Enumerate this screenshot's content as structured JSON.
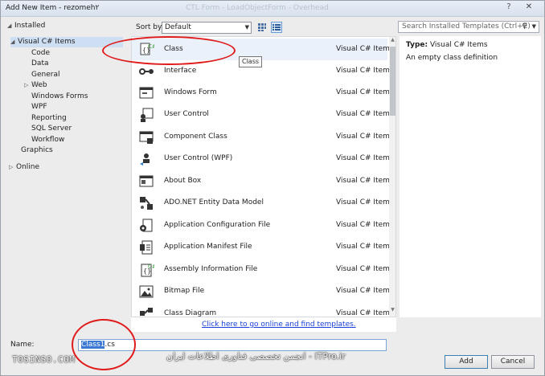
{
  "window": {
    "title": "Add New Item - rezomeh۲",
    "ghost_title": "CTL Form - LoadObjectForm - Overhead",
    "help_label": "?",
    "close_label": "✕"
  },
  "tree": {
    "installed": "Installed",
    "items": [
      {
        "label": "Visual C# Items",
        "selected": true
      },
      {
        "label": "Code"
      },
      {
        "label": "Data"
      },
      {
        "label": "General"
      },
      {
        "label": "Web"
      },
      {
        "label": "Windows Forms"
      },
      {
        "label": "WPF"
      },
      {
        "label": "Reporting"
      },
      {
        "label": "SQL Server"
      },
      {
        "label": "Workflow"
      },
      {
        "label": "Graphics"
      }
    ],
    "online": "Online"
  },
  "toolbar": {
    "sort_label": "Sort by:",
    "sort_value": "Default",
    "grid_view_icon": "grid-view-icon",
    "list_view_icon": "list-view-icon"
  },
  "search": {
    "placeholder": "Search Installed Templates (Ctrl+E)",
    "icon": "search-icon"
  },
  "templates": [
    {
      "name": "Class",
      "category": "Visual C# Items",
      "icon": "class-icon"
    },
    {
      "name": "Interface",
      "category": "Visual C# Items",
      "icon": "interface-icon"
    },
    {
      "name": "Windows Form",
      "category": "Visual C# Items",
      "icon": "windows-form-icon"
    },
    {
      "name": "User Control",
      "category": "Visual C# Items",
      "icon": "user-control-icon"
    },
    {
      "name": "Component Class",
      "category": "Visual C# Items",
      "icon": "component-class-icon"
    },
    {
      "name": "User Control (WPF)",
      "category": "Visual C# Items",
      "icon": "wpf-user-control-icon"
    },
    {
      "name": "About Box",
      "category": "Visual C# Items",
      "icon": "about-box-icon"
    },
    {
      "name": "ADO.NET Entity Data Model",
      "category": "Visual C# Items",
      "icon": "entity-model-icon"
    },
    {
      "name": "Application Configuration File",
      "category": "Visual C# Items",
      "icon": "config-file-icon"
    },
    {
      "name": "Application Manifest File",
      "category": "Visual C# Items",
      "icon": "manifest-file-icon"
    },
    {
      "name": "Assembly Information File",
      "category": "Visual C# Items",
      "icon": "assembly-info-icon"
    },
    {
      "name": "Bitmap File",
      "category": "Visual C# Items",
      "icon": "bitmap-file-icon"
    },
    {
      "name": "Class Diagram",
      "category": "Visual C# Items",
      "icon": "class-diagram-icon"
    }
  ],
  "tooltip": "Class",
  "online_link": "Click here to go online and find templates.",
  "info": {
    "type_label": "Type:",
    "type_value": "Visual C# Items",
    "description": "An empty class definition"
  },
  "name_field": {
    "label": "Name:",
    "value_selected": "Class1",
    "value_rest": ".cs"
  },
  "buttons": {
    "add": "Add",
    "cancel": "Cancel"
  },
  "watermarks": {
    "left": "TOSINSO.COM",
    "middle": "ITPro.ir - انجمن تخصصی فناوری اطلاعات ایران"
  }
}
